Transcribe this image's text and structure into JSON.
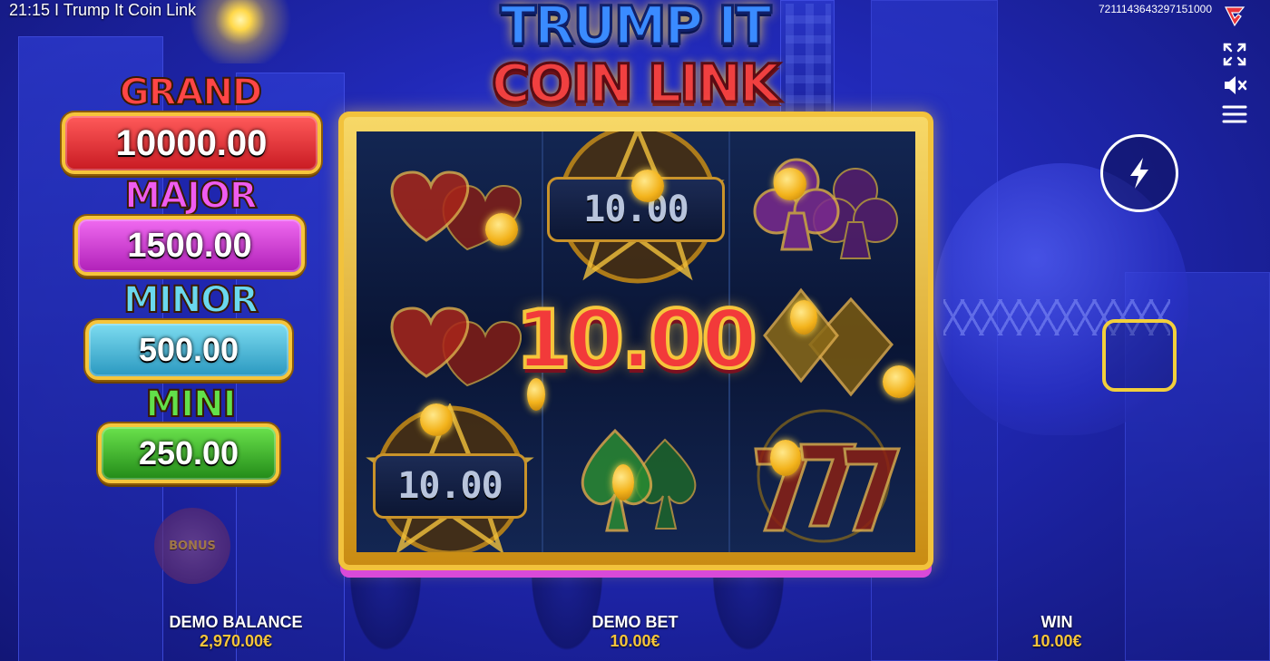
{
  "top_bar": {
    "title": "21:15 I Trump It Coin Link",
    "round_id": "7211143643297151000"
  },
  "logo": {
    "line1": "TRUMP IT",
    "line2": "COIN LINK"
  },
  "jackpots": [
    {
      "label": "GRAND",
      "value": "10000.00",
      "color": "#e8333b"
    },
    {
      "label": "MAJOR",
      "value": "1500.00",
      "color": "#d63ad6"
    },
    {
      "label": "MINOR",
      "value": "500.00",
      "color": "#3bb6d8"
    },
    {
      "label": "MINI",
      "value": "250.00",
      "color": "#36b82a"
    }
  ],
  "bonus_button": {
    "label": "BONUS"
  },
  "reels": {
    "cash_symbols": [
      {
        "value": "10.00"
      },
      {
        "value": "10.00"
      }
    ],
    "symbols": [
      "hearts",
      "cash-star",
      "clubs",
      "hearts",
      "cash-star",
      "diamonds",
      "cash-star",
      "spades",
      "sevens"
    ]
  },
  "win_display": {
    "amount": "10.00"
  },
  "bottom": {
    "balance": {
      "label": "DEMO BALANCE",
      "value": "2,970.00€"
    },
    "bet": {
      "label": "DEMO BET",
      "value": "10.00€"
    },
    "win": {
      "label": "WIN",
      "value": "10.00€"
    }
  },
  "icons": {
    "fullscreen": "fullscreen-icon",
    "sound": "sound-muted-icon",
    "menu": "menu-icon",
    "turbo": "lightning-icon",
    "stop": "stop-icon",
    "brand": "brand-logo-icon"
  },
  "colors": {
    "gold": "#f6c53b",
    "background": "#1a22a8"
  }
}
